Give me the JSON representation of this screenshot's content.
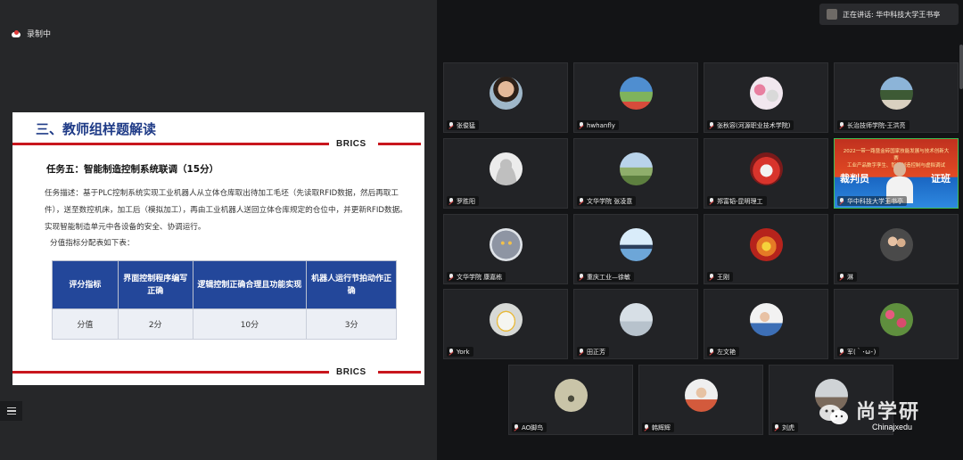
{
  "recording": {
    "label": "录制中"
  },
  "slide": {
    "title": "三、教师组样题解读",
    "brand": "BRICS",
    "task_title": "任务五：智能制造控制系统联调（15分）",
    "task_desc": "任务描述：基于PLC控制系统实现工业机器人从立体仓库取出待加工毛坯（先读取RFID数据，然后再取工件），送至数控机床，加工后（模拟加工），再由工业机器人送回立体仓库规定的仓位中，并更新RFID数据。实现智能制造单元中各设备的安全、协调运行。",
    "alloc_label": "分值指标分配表如下表：",
    "table": {
      "headers": [
        "评分指标",
        "界面控制程序编写正确",
        "逻辑控制正确合理且功能实现",
        "机器人运行节拍动作正确"
      ],
      "row_label": "分值",
      "values": [
        "2分",
        "10分",
        "3分"
      ]
    }
  },
  "speaking": {
    "text": "正在讲话: 华中科技大学王书亭"
  },
  "share_tile": {
    "line1": "2022一带一路暨金砖国家技能发展与技术创新大赛",
    "line2": "工业产品数字孪生、智能制造控制与虚拟调试",
    "big_left": "裁判员",
    "big_right": "证班"
  },
  "participants": [
    "张俊猛",
    "hwhanfly",
    "张秋容(河源职业技术学院)",
    "长治技师学院-王洪亮",
    "罗胜阳",
    "文华学院 张凌意",
    "郑富韬-昆明理工",
    "华中科技大学王书亭",
    "文华学院 康嘉栋",
    "重庆工业—徐敏",
    "王刚",
    "淋",
    "York",
    "田正芳",
    "左文艳",
    "军(｀･ω･)",
    "AO脚鸟",
    "韩辉辉",
    "刘虎"
  ],
  "watermark": {
    "cn": "尚学研",
    "en": "Chinajxedu"
  },
  "colors": {
    "slide_blue": "#1f3b87",
    "brics_red": "#c8161d",
    "table_header": "#23479a",
    "active_border": "#3fbf54"
  }
}
